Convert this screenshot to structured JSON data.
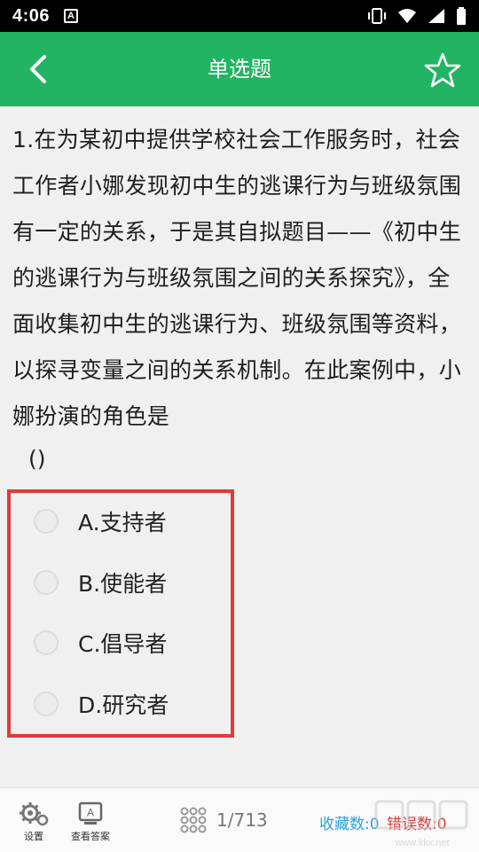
{
  "status_bar": {
    "time": "4:06",
    "notification_glyph": "A"
  },
  "header": {
    "title": "单选题"
  },
  "question": {
    "text": "1.在为某初中提供学校社会工作服务时，社会工作者小娜发现初中生的逃课行为与班级氛围有一定的关系，于是其自拟题目——《初中生的逃课行为与班级氛围之间的关系探究》，全面收集初中生的逃课行为、班级氛围等资料，以探寻变量之间的关系机制。在此案例中，小娜扮演的角色是",
    "blank": "()"
  },
  "options": [
    {
      "label": "A.支持者"
    },
    {
      "label": "B.使能者"
    },
    {
      "label": "C.倡导者"
    },
    {
      "label": "D.研究者"
    }
  ],
  "bottom_bar": {
    "settings_label": "设置",
    "answer_label": "查看答案",
    "answer_icon_letter": "A",
    "pager": "1/713",
    "favorites": "收藏数:0",
    "errors": "错误数:0",
    "watermark": "www.kkx.net"
  },
  "colors": {
    "header_green": "#22b462",
    "highlight_red": "#e03a3a",
    "favorites_blue": "#2aa1de"
  }
}
